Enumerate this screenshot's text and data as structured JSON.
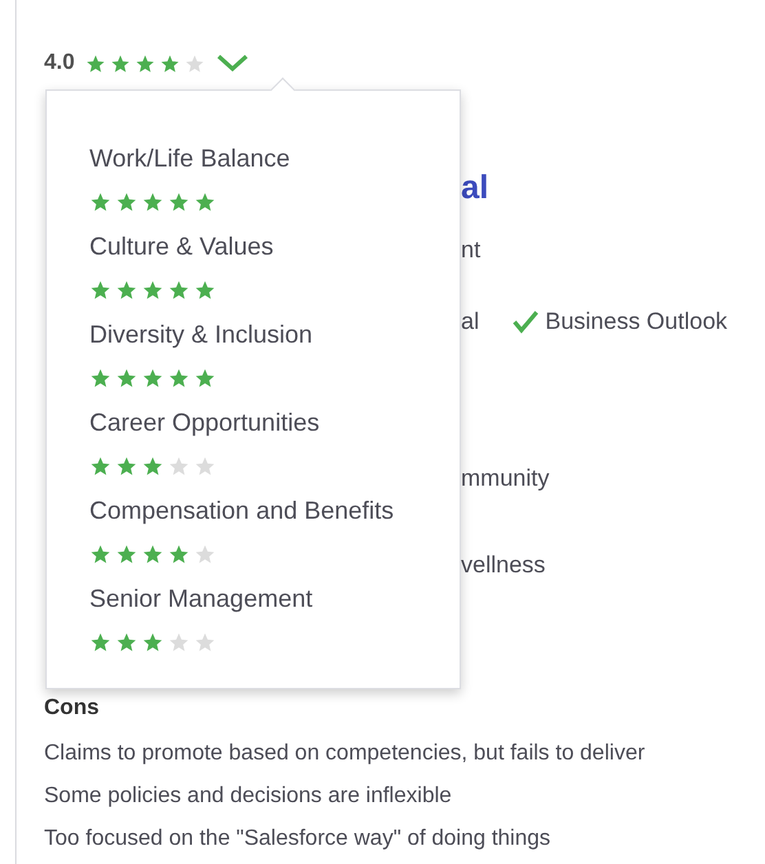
{
  "overall": {
    "rating": "4.0",
    "stars": 4
  },
  "popup": {
    "items": [
      {
        "label": "Work/Life Balance",
        "stars": 5
      },
      {
        "label": "Culture & Values",
        "stars": 5
      },
      {
        "label": "Diversity & Inclusion",
        "stars": 5
      },
      {
        "label": "Career Opportunities",
        "stars": 3
      },
      {
        "label": "Compensation and Benefits",
        "stars": 4
      },
      {
        "label": "Senior Management",
        "stars": 3
      }
    ]
  },
  "review": {
    "title_fragment": "al",
    "line_fragment_1": "nt",
    "line_fragment_2": "al",
    "business_outlook": {
      "label": "Business Outlook",
      "positive": true
    },
    "line_fragment_3": "mmunity",
    "line_fragment_4": "vellness"
  },
  "cons": {
    "heading": "Cons",
    "lines": [
      "Claims to promote based on competencies, but fails to deliver",
      "Some policies and decisions are inflexible",
      "Too focused on the \"Salesforce way\" of doing things"
    ]
  }
}
